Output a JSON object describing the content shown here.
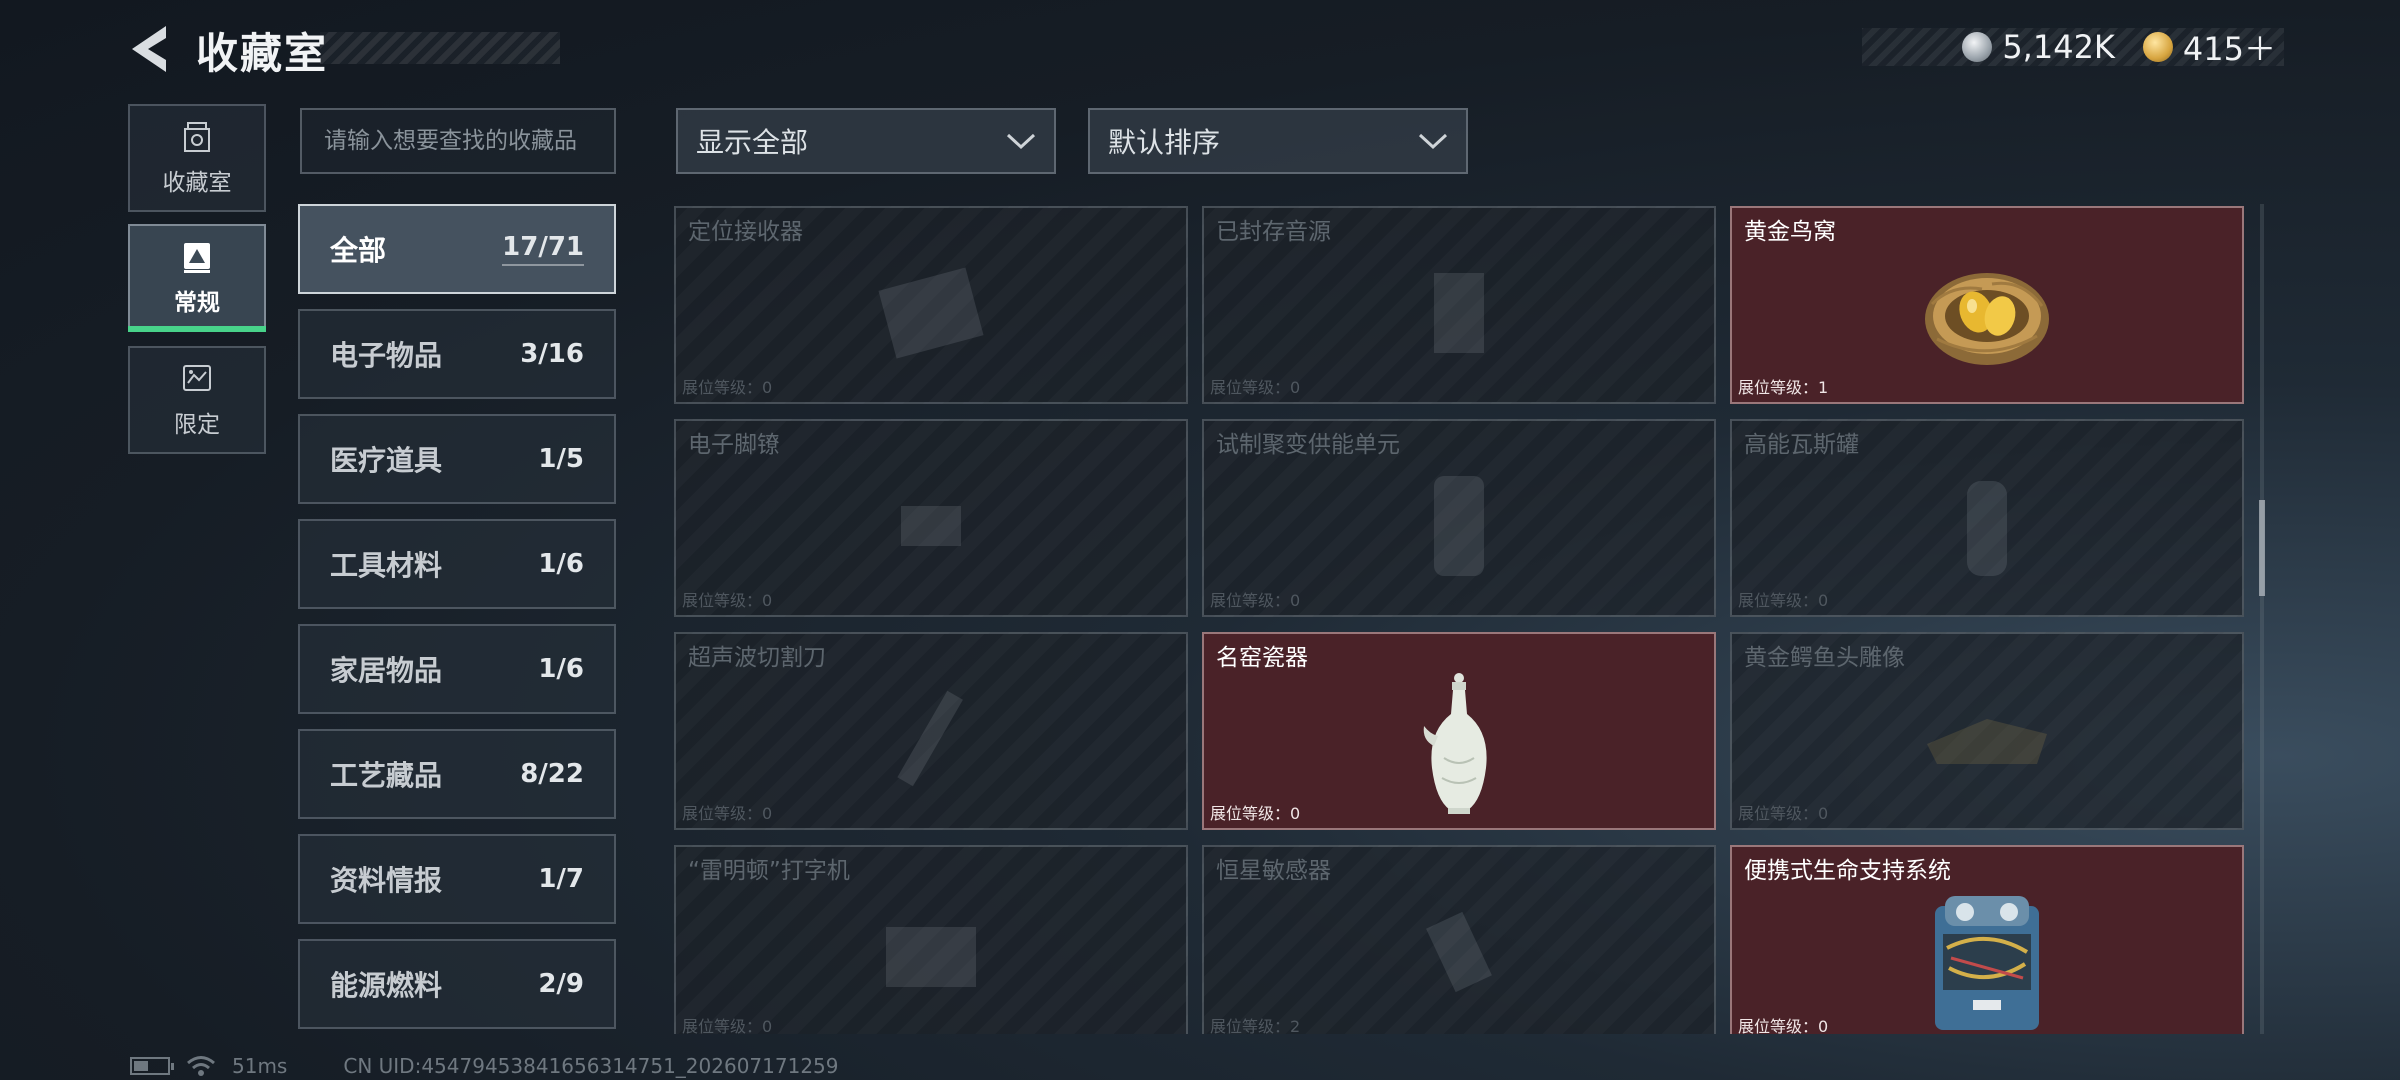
{
  "header": {
    "title": "收藏室"
  },
  "currency": [
    {
      "icon": "silver-coin-icon",
      "value": "5,142K"
    },
    {
      "icon": "gold-coin-icon",
      "value": "415＋"
    }
  ],
  "nav": [
    {
      "label": "收藏室",
      "icon": "collection-room-icon",
      "active": false
    },
    {
      "label": "常规",
      "icon": "regular-collection-icon",
      "active": true
    },
    {
      "label": "限定",
      "icon": "limited-collection-icon",
      "active": false
    }
  ],
  "search": {
    "placeholder": "请输入想要查找的收藏品"
  },
  "filters": {
    "display": "显示全部",
    "sort": "默认排序"
  },
  "categories": [
    {
      "name": "全部",
      "count": "17/71",
      "active": true
    },
    {
      "name": "电子物品",
      "count": "3/16"
    },
    {
      "name": "医疗道具",
      "count": "1/5"
    },
    {
      "name": "工具材料",
      "count": "1/6"
    },
    {
      "name": "家居物品",
      "count": "1/6"
    },
    {
      "name": "工艺藏品",
      "count": "8/22"
    },
    {
      "name": "资料情报",
      "count": "1/7"
    },
    {
      "name": "能源燃料",
      "count": "2/9"
    }
  ],
  "items": [
    {
      "name": "定位接收器",
      "level": "展位等级：0",
      "owned": false
    },
    {
      "name": "已封存音源",
      "level": "展位等级：0",
      "owned": false
    },
    {
      "name": "黄金鸟窝",
      "level": "展位等级：1",
      "owned": true,
      "art": "golden-nest"
    },
    {
      "name": "电子脚镣",
      "level": "展位等级：0",
      "owned": false
    },
    {
      "name": "试制聚变供能单元",
      "level": "展位等级：0",
      "owned": false
    },
    {
      "name": "高能瓦斯罐",
      "level": "展位等级：0",
      "owned": false
    },
    {
      "name": "超声波切割刀",
      "level": "展位等级：0",
      "owned": false
    },
    {
      "name": "名窑瓷器",
      "level": "展位等级：0",
      "owned": true,
      "art": "porcelain-vase"
    },
    {
      "name": "黄金鳄鱼头雕像",
      "level": "展位等级：0",
      "owned": false
    },
    {
      "name": "“雷明顿”打字机",
      "level": "展位等级：0",
      "owned": false
    },
    {
      "name": "恒星敏感器",
      "level": "展位等级：2",
      "owned": false
    },
    {
      "name": "便携式生命支持系统",
      "level": "展位等级：0",
      "owned": true,
      "art": "life-support"
    }
  ],
  "footer": {
    "ping": "51ms",
    "uid": "CN UID:4547945384165631475​1_202607171259"
  }
}
